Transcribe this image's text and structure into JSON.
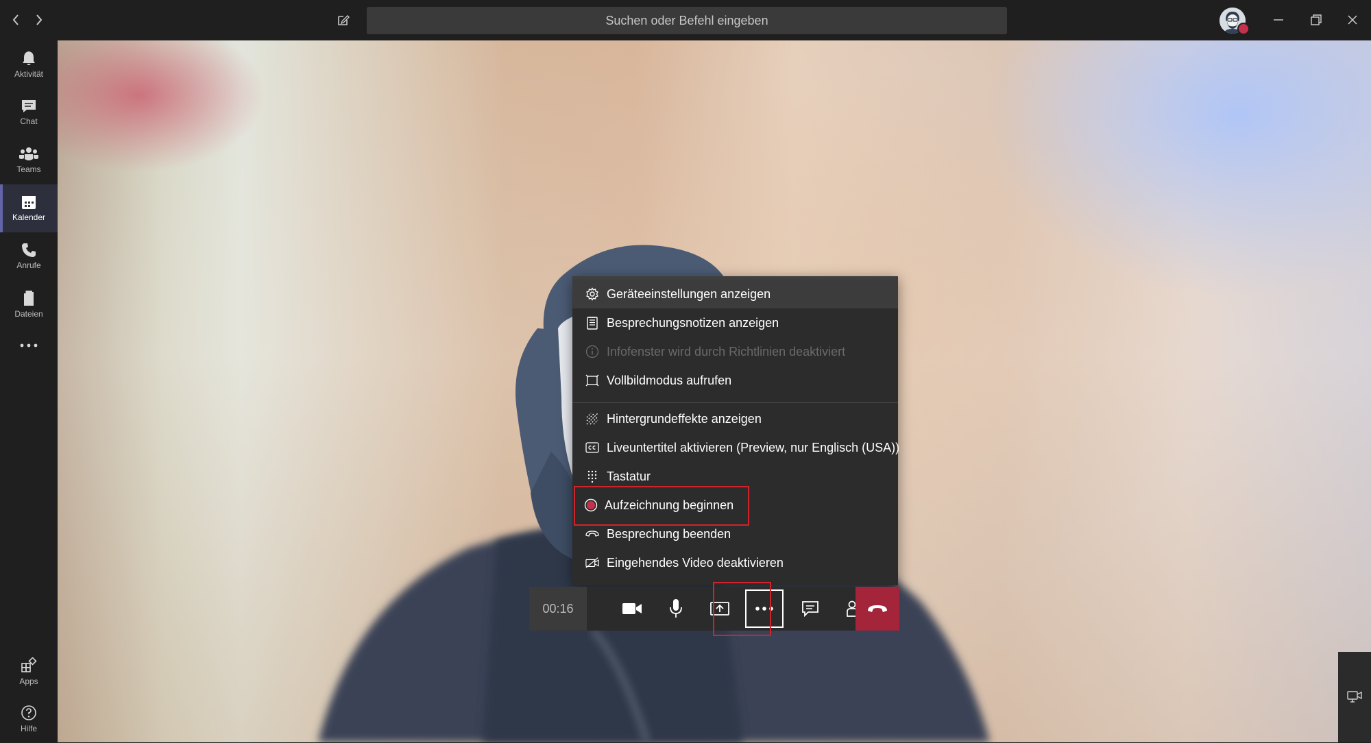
{
  "titlebar": {
    "search_placeholder": "Suchen oder Befehl eingeben",
    "icons": {
      "back": "chevron-left-icon",
      "forward": "chevron-right-icon",
      "compose": "compose-icon",
      "minimize": "minimize-icon",
      "maximize": "restore-icon",
      "close": "close-icon"
    },
    "presence_status_color": "#c4314b"
  },
  "rail": {
    "items": [
      {
        "label": "Aktivität",
        "icon": "bell-icon"
      },
      {
        "label": "Chat",
        "icon": "chat-icon"
      },
      {
        "label": "Teams",
        "icon": "teams-icon"
      },
      {
        "label": "Kalender",
        "icon": "calendar-icon",
        "active": true
      },
      {
        "label": "Anrufe",
        "icon": "phone-icon"
      },
      {
        "label": "Dateien",
        "icon": "file-icon"
      }
    ],
    "more_icon": "more-horizontal-icon",
    "bottom": [
      {
        "label": "Apps",
        "icon": "apps-icon"
      },
      {
        "label": "Hilfe",
        "icon": "help-icon"
      }
    ],
    "accent_color": "#6264a7"
  },
  "menu": {
    "items": [
      {
        "label": "Geräteeinstellungen anzeigen",
        "icon": "gear-icon",
        "state": "hover"
      },
      {
        "label": "Besprechungsnotizen anzeigen",
        "icon": "notes-icon"
      },
      {
        "label": "Infofenster wird durch Richtlinien deaktiviert",
        "icon": "info-icon",
        "state": "disabled"
      },
      {
        "label": "Vollbildmodus aufrufen",
        "icon": "fullscreen-icon"
      },
      {
        "label": "Hintergrundeffekte anzeigen",
        "icon": "background-effects-icon"
      },
      {
        "label": "Liveuntertitel aktivieren (Preview, nur Englisch (USA))",
        "icon": "captions-icon"
      },
      {
        "label": "Tastatur",
        "icon": "keypad-icon"
      },
      {
        "label": "Aufzeichnung beginnen",
        "icon": "record-icon",
        "highlighted": true
      },
      {
        "label": "Besprechung beenden",
        "icon": "end-meeting-icon"
      },
      {
        "label": "Eingehendes Video deaktivieren",
        "icon": "video-off-icon"
      }
    ],
    "highlight_color": "#d1232b"
  },
  "controls": {
    "timer": "00:16",
    "buttons": [
      {
        "name": "camera",
        "icon": "camera-icon"
      },
      {
        "name": "microphone",
        "icon": "microphone-icon"
      },
      {
        "name": "share",
        "icon": "share-screen-icon"
      },
      {
        "name": "more",
        "icon": "more-options-icon",
        "highlighted": true
      },
      {
        "name": "chat",
        "icon": "chat-icon"
      },
      {
        "name": "participants",
        "icon": "participants-icon"
      },
      {
        "name": "hangup",
        "icon": "hangup-icon"
      }
    ],
    "hangup_color": "#a4243a"
  },
  "side_panel": {
    "icon": "device-video-icon"
  }
}
